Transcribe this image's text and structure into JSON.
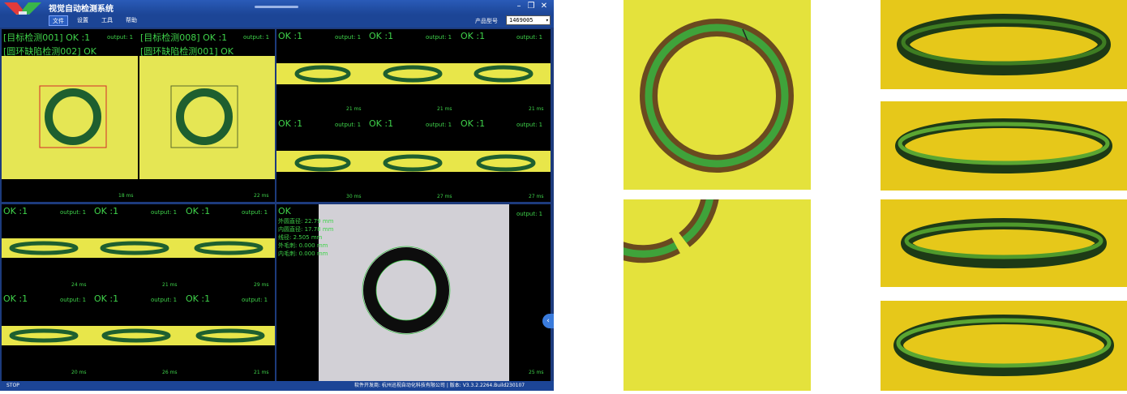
{
  "window": {
    "title": "视觉自动检测系统",
    "minimize_icon": "minimize-icon",
    "restore_icon": "restore-icon",
    "close_icon": "close-icon",
    "minimize_glyph": "–",
    "restore_glyph": "❐",
    "close_glyph": "✕"
  },
  "menu": {
    "items": [
      "文件",
      "设置",
      "工具",
      "帮助"
    ]
  },
  "product": {
    "label": "产品型号",
    "value": "1469005"
  },
  "colors": {
    "accent": "#1c4596",
    "text_green": "#3fd24a",
    "strip_yellow": "#e8e64a",
    "ring_green": "#1f6a2a"
  },
  "panels": {
    "top_left": {
      "left_title": "[目标检测001] OK :1",
      "left_sub": "[圆环缺陷检测002] OK",
      "left_output": "output: 1",
      "left_ms": "18 ms",
      "right_title": "[目标检测008] OK :1",
      "right_sub": "[圆环缺陷检测001] OK",
      "right_output": "output: 1",
      "right_ms": "22 ms"
    },
    "top_right": {
      "rows": [
        {
          "ok": [
            "OK :1",
            "OK :1",
            "OK :1"
          ],
          "outputs": [
            "output: 1",
            "output: 1",
            "output: 1"
          ],
          "ms": [
            "21 ms",
            "21 ms",
            "21 ms"
          ]
        },
        {
          "ok": [
            "OK :1",
            "OK :1",
            "OK :1"
          ],
          "outputs": [
            "output: 1",
            "output: 1",
            "output: 1"
          ],
          "ms": [
            "30 ms",
            "27 ms",
            "27 ms"
          ]
        }
      ]
    },
    "bottom_left": {
      "rows": [
        {
          "ok": [
            "OK :1",
            "OK :1",
            "OK :1"
          ],
          "outputs": [
            "output: 1",
            "output: 1",
            "output: 1"
          ],
          "ms": [
            "24 ms",
            "21 ms",
            "29 ms"
          ]
        },
        {
          "ok": [
            "OK :1",
            "OK :1",
            "OK :1"
          ],
          "outputs": [
            "output: 1",
            "output: 1",
            "output: 1"
          ],
          "ms": [
            "20 ms",
            "26 ms",
            "21 ms"
          ]
        }
      ]
    },
    "bottom_right": {
      "status": "OK",
      "output": "output: 1",
      "ms": "25 ms",
      "measurements": [
        "外圆直径: 22.79 mm",
        "内圆直径: 17.78 mm",
        "线径: 2.505 mm",
        "外毛刺: 0.000 mm",
        "内毛刺: 0.000 mm"
      ]
    }
  },
  "statusbar": {
    "left": "STOP",
    "right": "软件开发商: 杭州迅视自动化科技有限公司  |  版本: V3.3.2.2264.Build230107"
  }
}
